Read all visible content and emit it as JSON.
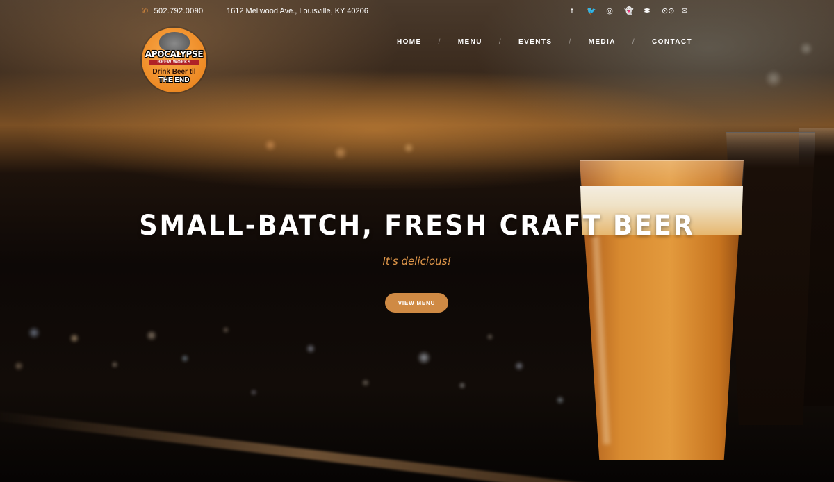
{
  "topbar": {
    "phone_icon": "phone-icon",
    "phone": "502.792.0090",
    "address": "1612 Mellwood Ave., Louisville, KY 40206",
    "social": [
      {
        "name": "facebook-icon",
        "glyph": "f"
      },
      {
        "name": "twitter-icon",
        "glyph": "🐦"
      },
      {
        "name": "instagram-icon",
        "glyph": "◎"
      },
      {
        "name": "snapchat-icon",
        "glyph": "👻"
      },
      {
        "name": "yelp-icon",
        "glyph": "✱"
      },
      {
        "name": "tripadvisor-icon",
        "glyph": "⊙⊙"
      },
      {
        "name": "email-icon",
        "glyph": "✉"
      }
    ]
  },
  "logo": {
    "name": "APOCALYPSE",
    "band": "BREW WORKS",
    "tagline_line1": "Drink Beer til",
    "tagline_line2": "THE END"
  },
  "nav": {
    "items": [
      "HOME",
      "MENU",
      "EVENTS",
      "MEDIA",
      "CONTACT"
    ],
    "separator": "/"
  },
  "hero": {
    "headline": "SMALL-BATCH, FRESH CRAFT BEER",
    "subline": "It's delicious!",
    "cta_label": "VIEW MENU"
  },
  "colors": {
    "accent": "#cf8a44",
    "subline": "#e0974a",
    "logo_orange": "#ee8a24"
  }
}
